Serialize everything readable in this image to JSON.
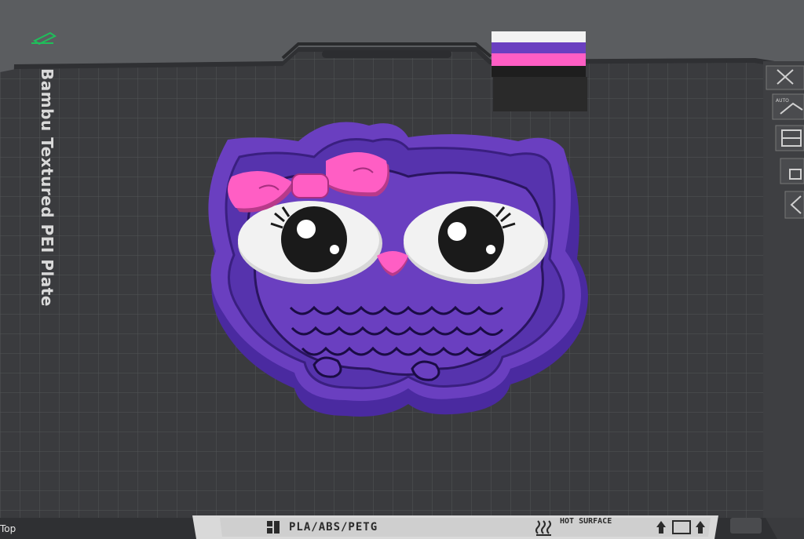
{
  "plate": {
    "name": "Bambu Textured PEI Plate"
  },
  "bottom_bar": {
    "material": "PLA/ABS/PETG",
    "warning": "HOT SURFACE"
  },
  "view": {
    "label": "Top"
  },
  "toolbar": {
    "buttons": [
      {
        "icon": "close-icon"
      },
      {
        "icon": "auto-orient-icon",
        "tag": "AUTO"
      },
      {
        "icon": "arrange-icon"
      },
      {
        "icon": "lock-icon"
      },
      {
        "icon": "chevron-left-icon"
      }
    ]
  },
  "colors": {
    "background": "#5b5d60",
    "plate": "#3a3b3e",
    "owl_purple": "#6a3fc0",
    "bow_pink": "#ff5ec4",
    "eye_white": "#f2f2f2",
    "prime_tower_dark": "#2a2a2a"
  }
}
